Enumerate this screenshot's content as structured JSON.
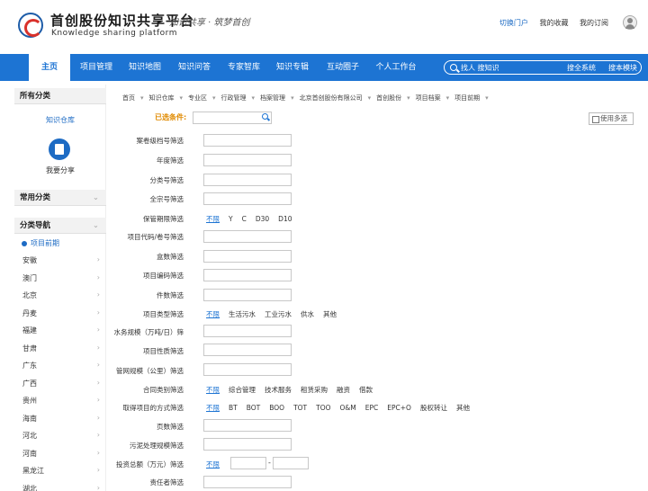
{
  "header": {
    "title": "首创股份知识共享平台",
    "subtitle": "Knowledge sharing platform",
    "slogan": "知识共享 · 筑梦首创",
    "links": [
      "切换门户",
      "我的收藏",
      "我的订阅"
    ]
  },
  "nav": {
    "items": [
      "主页",
      "项目管理",
      "知识地图",
      "知识问答",
      "专家智库",
      "知识专辑",
      "互动圈子",
      "个人工作台"
    ],
    "search_placeholder": "找人 搜知识",
    "search_all": "搜全系统",
    "search_module": "搜本模块"
  },
  "sidebar": {
    "all_categories": "所有分类",
    "knowledge_base": "知识仓库",
    "share": "我要分享",
    "common_categories": "常用分类",
    "category_nav": "分类导航",
    "project_node": "项目前期",
    "provinces": [
      "安徽",
      "澳门",
      "北京",
      "丹麦",
      "福建",
      "甘肃",
      "广东",
      "广西",
      "贵州",
      "海南",
      "河北",
      "河南",
      "黑龙江",
      "湖北"
    ]
  },
  "breadcrumb": [
    "首页",
    "知识仓库",
    "专业区",
    "行政管理",
    "档案管理",
    "北京首创股份有限公司",
    "首创股份",
    "项目档案",
    "项目前期"
  ],
  "filters": {
    "selected_label": "已选条件:",
    "multi_select": "使用多选",
    "text_fields": [
      "案卷级档号筛选",
      "年度筛选",
      "分类号筛选",
      "全宗号筛选"
    ],
    "retention": {
      "label": "保管期限筛选",
      "options": [
        "不限",
        "Y",
        "C",
        "D30",
        "D10"
      ]
    },
    "text_fields_2": [
      "项目代码/卷号筛选",
      "盒数筛选",
      "项目编码筛选",
      "件数筛选"
    ],
    "project_type": {
      "label": "项目类型筛选",
      "options": [
        "不限",
        "生活污水",
        "工业污水",
        "供水",
        "其他"
      ]
    },
    "water_scale": "水务规模（万吨/日）筛",
    "project_nature": "项目性质筛选",
    "pipe_scale": "管网规模（公里）筛选",
    "contract_type": {
      "label": "合同类别筛选",
      "options": [
        "不限",
        "综合管理",
        "技术服务",
        "租赁采购",
        "融资",
        "借款"
      ]
    },
    "acquisition": {
      "label": "取得项目的方式筛选",
      "options": [
        "不限",
        "BT",
        "BOT",
        "BOO",
        "TOT",
        "TOO",
        "O&M",
        "EPC",
        "EPC+O",
        "股权转让",
        "其他"
      ]
    },
    "page_count": "页数筛选",
    "sludge_scale": "污泥处理规模筛选",
    "investment": {
      "label": "投资总额（万元）筛选",
      "option": "不限",
      "dash": "-"
    },
    "owner": "责任者筛选"
  }
}
